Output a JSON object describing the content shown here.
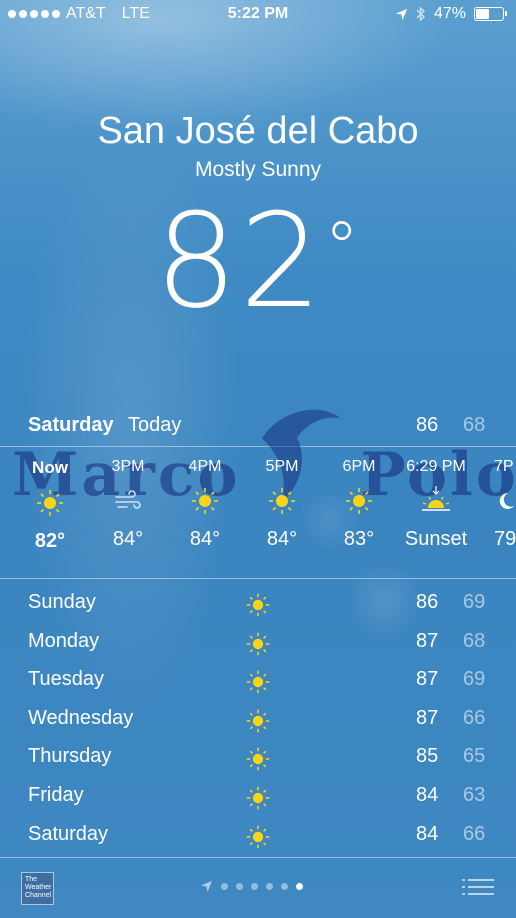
{
  "status": {
    "carrier": "AT&T",
    "network": "LTE",
    "time": "5:22 PM",
    "battery": "47%"
  },
  "location": {
    "city": "San José del Cabo",
    "condition": "Mostly Sunny",
    "temp": "82",
    "degree": "°"
  },
  "today": {
    "day": "Saturday",
    "label": "Today",
    "high": "86",
    "low": "68"
  },
  "hourly": [
    {
      "label": "Now",
      "icon": "sun-icon",
      "value": "82°"
    },
    {
      "label": "3PM",
      "icon": "wind-icon",
      "value": "84°"
    },
    {
      "label": "4PM",
      "icon": "sun-icon",
      "value": "84°"
    },
    {
      "label": "5PM",
      "icon": "sun-icon",
      "value": "84°"
    },
    {
      "label": "6PM",
      "icon": "sun-icon",
      "value": "83°"
    },
    {
      "label": "6:29 PM",
      "icon": "sunset-icon",
      "value": "Sunset"
    },
    {
      "label": "7P",
      "icon": "moon-icon",
      "value": "79"
    }
  ],
  "daily": [
    {
      "day": "Sunday",
      "icon": "sun-icon",
      "high": "86",
      "low": "69"
    },
    {
      "day": "Monday",
      "icon": "sun-icon",
      "high": "87",
      "low": "68"
    },
    {
      "day": "Tuesday",
      "icon": "sun-icon",
      "high": "87",
      "low": "69"
    },
    {
      "day": "Wednesday",
      "icon": "sun-icon",
      "high": "87",
      "low": "66"
    },
    {
      "day": "Thursday",
      "icon": "sun-icon",
      "high": "85",
      "low": "65"
    },
    {
      "day": "Friday",
      "icon": "sun-icon",
      "high": "84",
      "low": "63"
    },
    {
      "day": "Saturday",
      "icon": "sun-icon",
      "high": "84",
      "low": "66"
    }
  ],
  "watermark": {
    "left": "Marco",
    "right": "Polo"
  },
  "footer": {
    "logo_text": "The Weather Channel"
  },
  "colors": {
    "sun": "#f7d417",
    "lowTemp": "rgba(255,255,255,0.55)"
  }
}
